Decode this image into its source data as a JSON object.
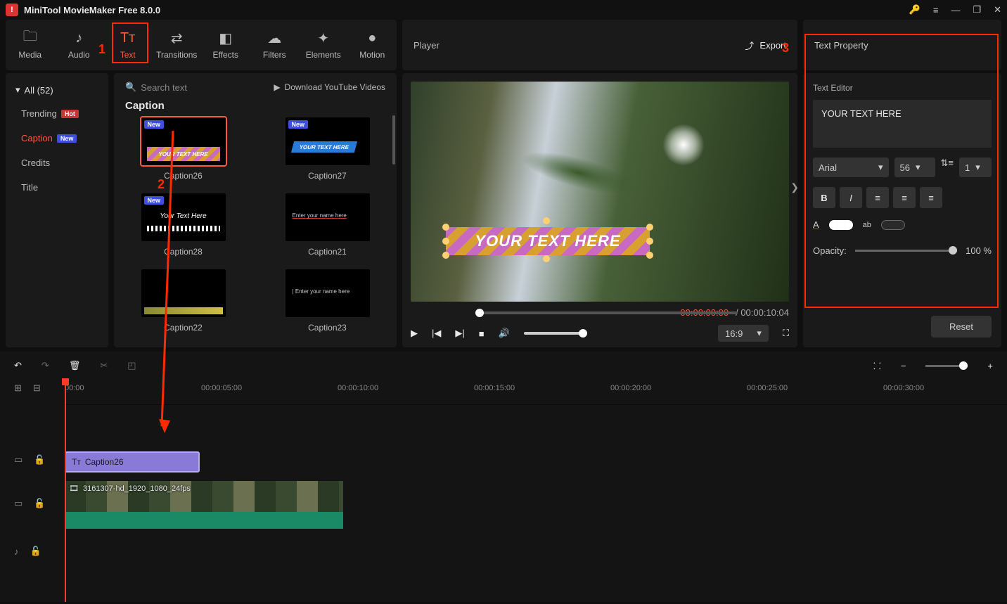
{
  "app": {
    "title": "MiniTool MovieMaker Free 8.0.0"
  },
  "toolbar": {
    "tabs": [
      "Media",
      "Audio",
      "Text",
      "Transitions",
      "Effects",
      "Filters",
      "Elements",
      "Motion"
    ],
    "active": "Text"
  },
  "player_header": {
    "title": "Player",
    "export": "Export"
  },
  "prop_header": {
    "title": "Text Property"
  },
  "categories": {
    "header": "All (52)",
    "items": [
      {
        "label": "Trending",
        "badge": "Hot"
      },
      {
        "label": "Caption",
        "badge": "New",
        "active": true
      },
      {
        "label": "Credits"
      },
      {
        "label": "Title"
      }
    ]
  },
  "gallery": {
    "search_placeholder": "Search text",
    "download": "Download YouTube Videos",
    "section": "Caption",
    "thumbs": [
      {
        "name": "Caption26",
        "new": true,
        "sel": true,
        "text": "YOUR TEXT HERE"
      },
      {
        "name": "Caption27",
        "new": true,
        "text": "YOUR TEXT HERE"
      },
      {
        "name": "Caption28",
        "new": true,
        "text": "Your Text Here"
      },
      {
        "name": "Caption21",
        "text": "Enter your name here"
      },
      {
        "name": "Caption22"
      },
      {
        "name": "Caption23",
        "text": "Enter your name here"
      }
    ]
  },
  "preview": {
    "overlay_text": "YOUR TEXT HERE"
  },
  "seek": {
    "current": "00:00:00:00",
    "total": "00:00:10:04",
    "sep": " / "
  },
  "controls": {
    "ratio": "16:9"
  },
  "text_property": {
    "editor_label": "Text Editor",
    "editor_value": "YOUR TEXT HERE",
    "font": "Arial",
    "size": "56",
    "line": "1",
    "opacity_label": "Opacity:",
    "opacity_value": "100 %",
    "reset": "Reset"
  },
  "timeline": {
    "ticks": [
      "00:00",
      "00:00:05:00",
      "00:00:10:00",
      "00:00:15:00",
      "00:00:20:00",
      "00:00:25:00",
      "00:00:30:00"
    ],
    "text_clip": "Caption26",
    "video_clip": "3161307-hd_1920_1080_24fps"
  },
  "ann": {
    "n1": "1",
    "n2": "2",
    "n3": "3"
  }
}
